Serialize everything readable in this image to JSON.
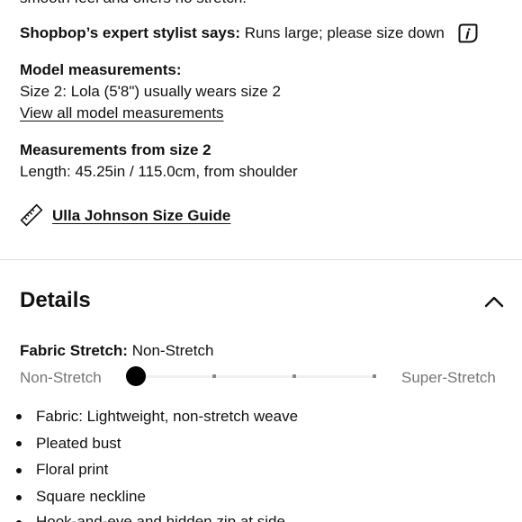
{
  "top_clipped_text": "smooth feel and offers no stretch.",
  "stylist": {
    "label": "Shopbop’s expert stylist says:",
    "text": "Runs large; please size down"
  },
  "model": {
    "heading": "Model measurements:",
    "line": "Size 2: Lola (5'8\") usually wears size 2",
    "link": "View all model measurements"
  },
  "measurements": {
    "heading": "Measurements from size 2",
    "line": "Length: 45.25in / 115.0cm, from shoulder"
  },
  "size_guide": {
    "link": "Ulla Johnson Size Guide"
  },
  "details": {
    "title": "Details",
    "fabric_label": "Fabric Stretch:",
    "fabric_value": "Non-Stretch",
    "scale_min": "Non-Stretch",
    "scale_max": "Super-Stretch",
    "stretch_level": 0,
    "bullets": [
      "Fabric: Lightweight, non-stretch weave",
      "Pleated bust",
      "Floral print",
      "Square neckline",
      "Hook-and-eye and hidden zip at side"
    ]
  }
}
